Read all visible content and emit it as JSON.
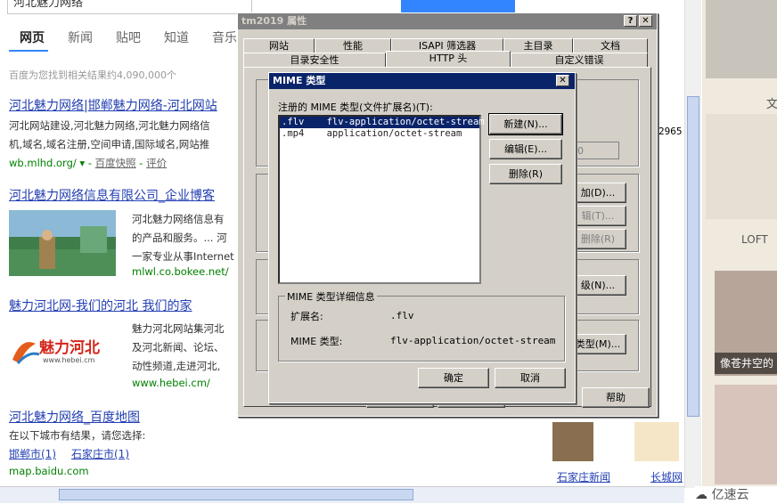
{
  "baidu": {
    "search_value": "河北魅力网络",
    "tabs": [
      "网页",
      "新闻",
      "贴吧",
      "知道",
      "音乐"
    ],
    "result_count": "百度为您找到相关结果约4,090,000个",
    "results": [
      {
        "title": "河北魅力网络|邯郸魅力网络-河北网站",
        "desc1": "河北网站建设,河北魅力网络,河北魅力网络信",
        "desc2": "机,域名,域名注册,空间申请,国际域名,网站推",
        "url": "wb.mlhd.org/",
        "snap": "百度快照",
        "rate": "评价"
      },
      {
        "title": "河北魅力网络信息有限公司_企业博客",
        "desc1": "河北魅力网络信息有",
        "desc2": "的产品和服务。... 河",
        "desc3": "一家专业从事Internet",
        "url": "mlwl.co.bokee.net/"
      },
      {
        "title": "魅力河北网-我们的河北 我们的家",
        "desc1": "魅力河北网站集河北",
        "desc2": "及河北新闻、论坛、",
        "desc3": "动性频道,走进河北,",
        "url": "www.hebei.cm/",
        "logo_text": "魅力河北",
        "logo_sub": "www.hebei.cm"
      },
      {
        "title": "河北魅力网络_百度地图",
        "desc1": "在以下城市有结果，请您选择:",
        "cities": [
          "邯郸市(1)",
          "石家庄市(1)"
        ],
        "url": "map.baidu.com"
      }
    ],
    "right_text": [
      "文",
      "LOFT",
      "像苍井空的"
    ],
    "bottom_links": [
      "石家庄新闻",
      "长城网"
    ]
  },
  "props_window": {
    "title": "tm2019 属性",
    "help_btn": "?",
    "close_btn": "✕",
    "tabs_row1": [
      "网站",
      "性能",
      "ISAPI 筛选器",
      "主目录",
      "文档"
    ],
    "tabs_row2": [
      "目录安全性",
      "HTTP 头",
      "自定义错误"
    ],
    "partial_value": "2965",
    "spin_value": "0",
    "partial_btns": [
      "加(D)...",
      "辑(T)...",
      "删除(R)",
      "级(N)...",
      "类型(M)..."
    ],
    "bottom_btn": "帮助"
  },
  "mime_dialog": {
    "title": "MIME 类型",
    "close_btn": "✕",
    "list_label": "注册的 MIME 类型(文件扩展名)(T):",
    "types": [
      {
        "ext": ".flv",
        "mime": "flv-application/octet-stream",
        "selected": true
      },
      {
        "ext": ".mp4",
        "mime": "application/octet-stream",
        "selected": false
      }
    ],
    "new_btn": "新建(N)...",
    "edit_btn": "编辑(E)...",
    "delete_btn": "删除(R)",
    "detail_group": "MIME 类型详细信息",
    "ext_label": "扩展名:",
    "ext_value": ".flv",
    "mime_label": "MIME 类型:",
    "mime_value": "flv-application/octet-stream",
    "ok_btn": "确定",
    "cancel_btn": "取消"
  },
  "brand": "亿速云"
}
